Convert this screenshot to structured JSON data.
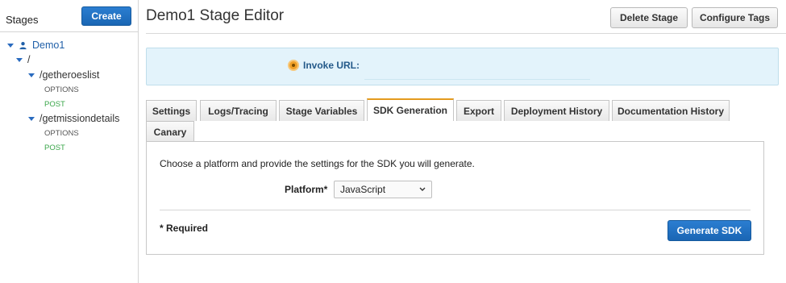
{
  "sidebar": {
    "title": "Stages",
    "create_label": "Create",
    "tree": {
      "stage_name": "Demo1",
      "root_path": "/",
      "resources": [
        {
          "path": "/getheroeslist",
          "methods": [
            "OPTIONS",
            "POST"
          ]
        },
        {
          "path": "/getmissiondetails",
          "methods": [
            "OPTIONS",
            "POST"
          ]
        }
      ]
    }
  },
  "header": {
    "title": "Demo1 Stage Editor",
    "delete_label": "Delete Stage",
    "tags_label": "Configure Tags"
  },
  "invoke": {
    "label": "Invoke URL:"
  },
  "tabs": [
    {
      "label": "Settings"
    },
    {
      "label": "Logs/Tracing"
    },
    {
      "label": "Stage Variables"
    },
    {
      "label": "SDK Generation",
      "active": true
    },
    {
      "label": "Export"
    },
    {
      "label": "Deployment History"
    },
    {
      "label": "Documentation History"
    },
    {
      "label": "Canary"
    }
  ],
  "sdk_panel": {
    "description": "Choose a platform and provide the settings for the SDK you will generate.",
    "platform_label": "Platform*",
    "platform_value": "JavaScript",
    "required_note": "* Required",
    "generate_label": "Generate SDK"
  },
  "colors": {
    "primary_button": "#1f70c1",
    "active_tab_accent": "#e49a1e",
    "post_method": "#3aa64a",
    "link_blue": "#1f5fa8",
    "invoke_bg": "#e3f3fb"
  }
}
